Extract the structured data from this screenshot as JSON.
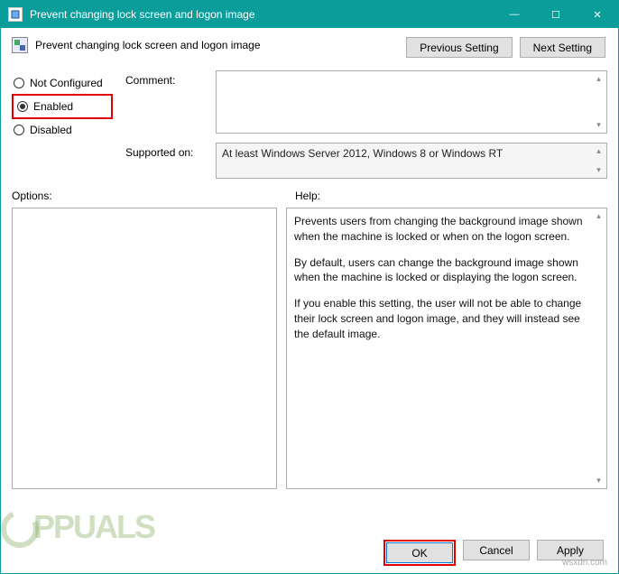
{
  "window": {
    "title": "Prevent changing lock screen and logon image",
    "minimize": "—",
    "maximize": "☐",
    "close": "✕"
  },
  "header": {
    "policy_title": "Prevent changing lock screen and logon image",
    "prev_setting": "Previous Setting",
    "next_setting": "Next Setting"
  },
  "state": {
    "not_configured": "Not Configured",
    "enabled": "Enabled",
    "disabled": "Disabled"
  },
  "fields": {
    "comment_label": "Comment:",
    "comment_value": "",
    "supported_label": "Supported on:",
    "supported_value": "At least Windows Server 2012, Windows 8 or Windows RT"
  },
  "panes": {
    "options_label": "Options:",
    "help_label": "Help:",
    "help_p1": "Prevents users from changing the background image shown when the machine is locked or when on the logon screen.",
    "help_p2": "By default, users can change the background image shown when the machine is locked or displaying the logon screen.",
    "help_p3": "If you enable this setting, the user will not be able to change their lock screen and logon image, and they will instead see the default image."
  },
  "footer": {
    "ok": "OK",
    "cancel": "Cancel",
    "apply": "Apply"
  },
  "watermark": {
    "site": "wsxdn.com",
    "logo": "PPUALS"
  }
}
